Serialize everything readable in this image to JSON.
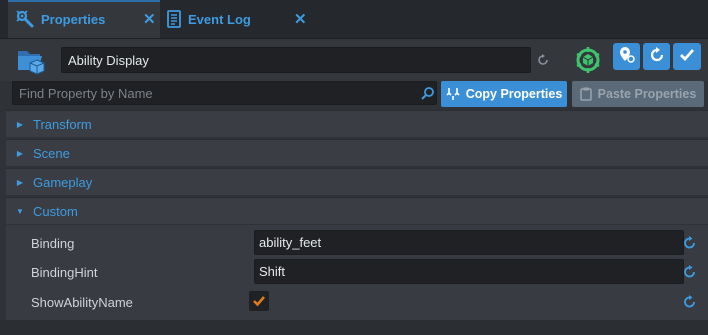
{
  "tabs": [
    {
      "label": "Properties",
      "icon": "wrench-gear-icon",
      "active": true
    },
    {
      "label": "Event Log",
      "icon": "document-icon",
      "active": false
    }
  ],
  "close_glyph": "✕",
  "header": {
    "name_value": "Ability Display",
    "object_icon": "folder-cube-icon",
    "status_icon": "green-networked-icon"
  },
  "search": {
    "placeholder": "Find Property by Name",
    "copy_label": "Copy Properties",
    "paste_label": "Paste Properties"
  },
  "sections": [
    {
      "label": "Transform",
      "expanded": false
    },
    {
      "label": "Scene",
      "expanded": false
    },
    {
      "label": "Gameplay",
      "expanded": false
    },
    {
      "label": "Custom",
      "expanded": true
    }
  ],
  "custom_properties": [
    {
      "label": "Binding",
      "value": "ability_feet"
    },
    {
      "label": "BindingHint",
      "value": "Shift"
    },
    {
      "label": "ShowAbilityName",
      "checked": true
    }
  ],
  "colors": {
    "accent": "#3b8fd6",
    "tab_text": "#3e9be0",
    "checkmark": "#e07a1f",
    "status_green": "#3ec46d"
  }
}
